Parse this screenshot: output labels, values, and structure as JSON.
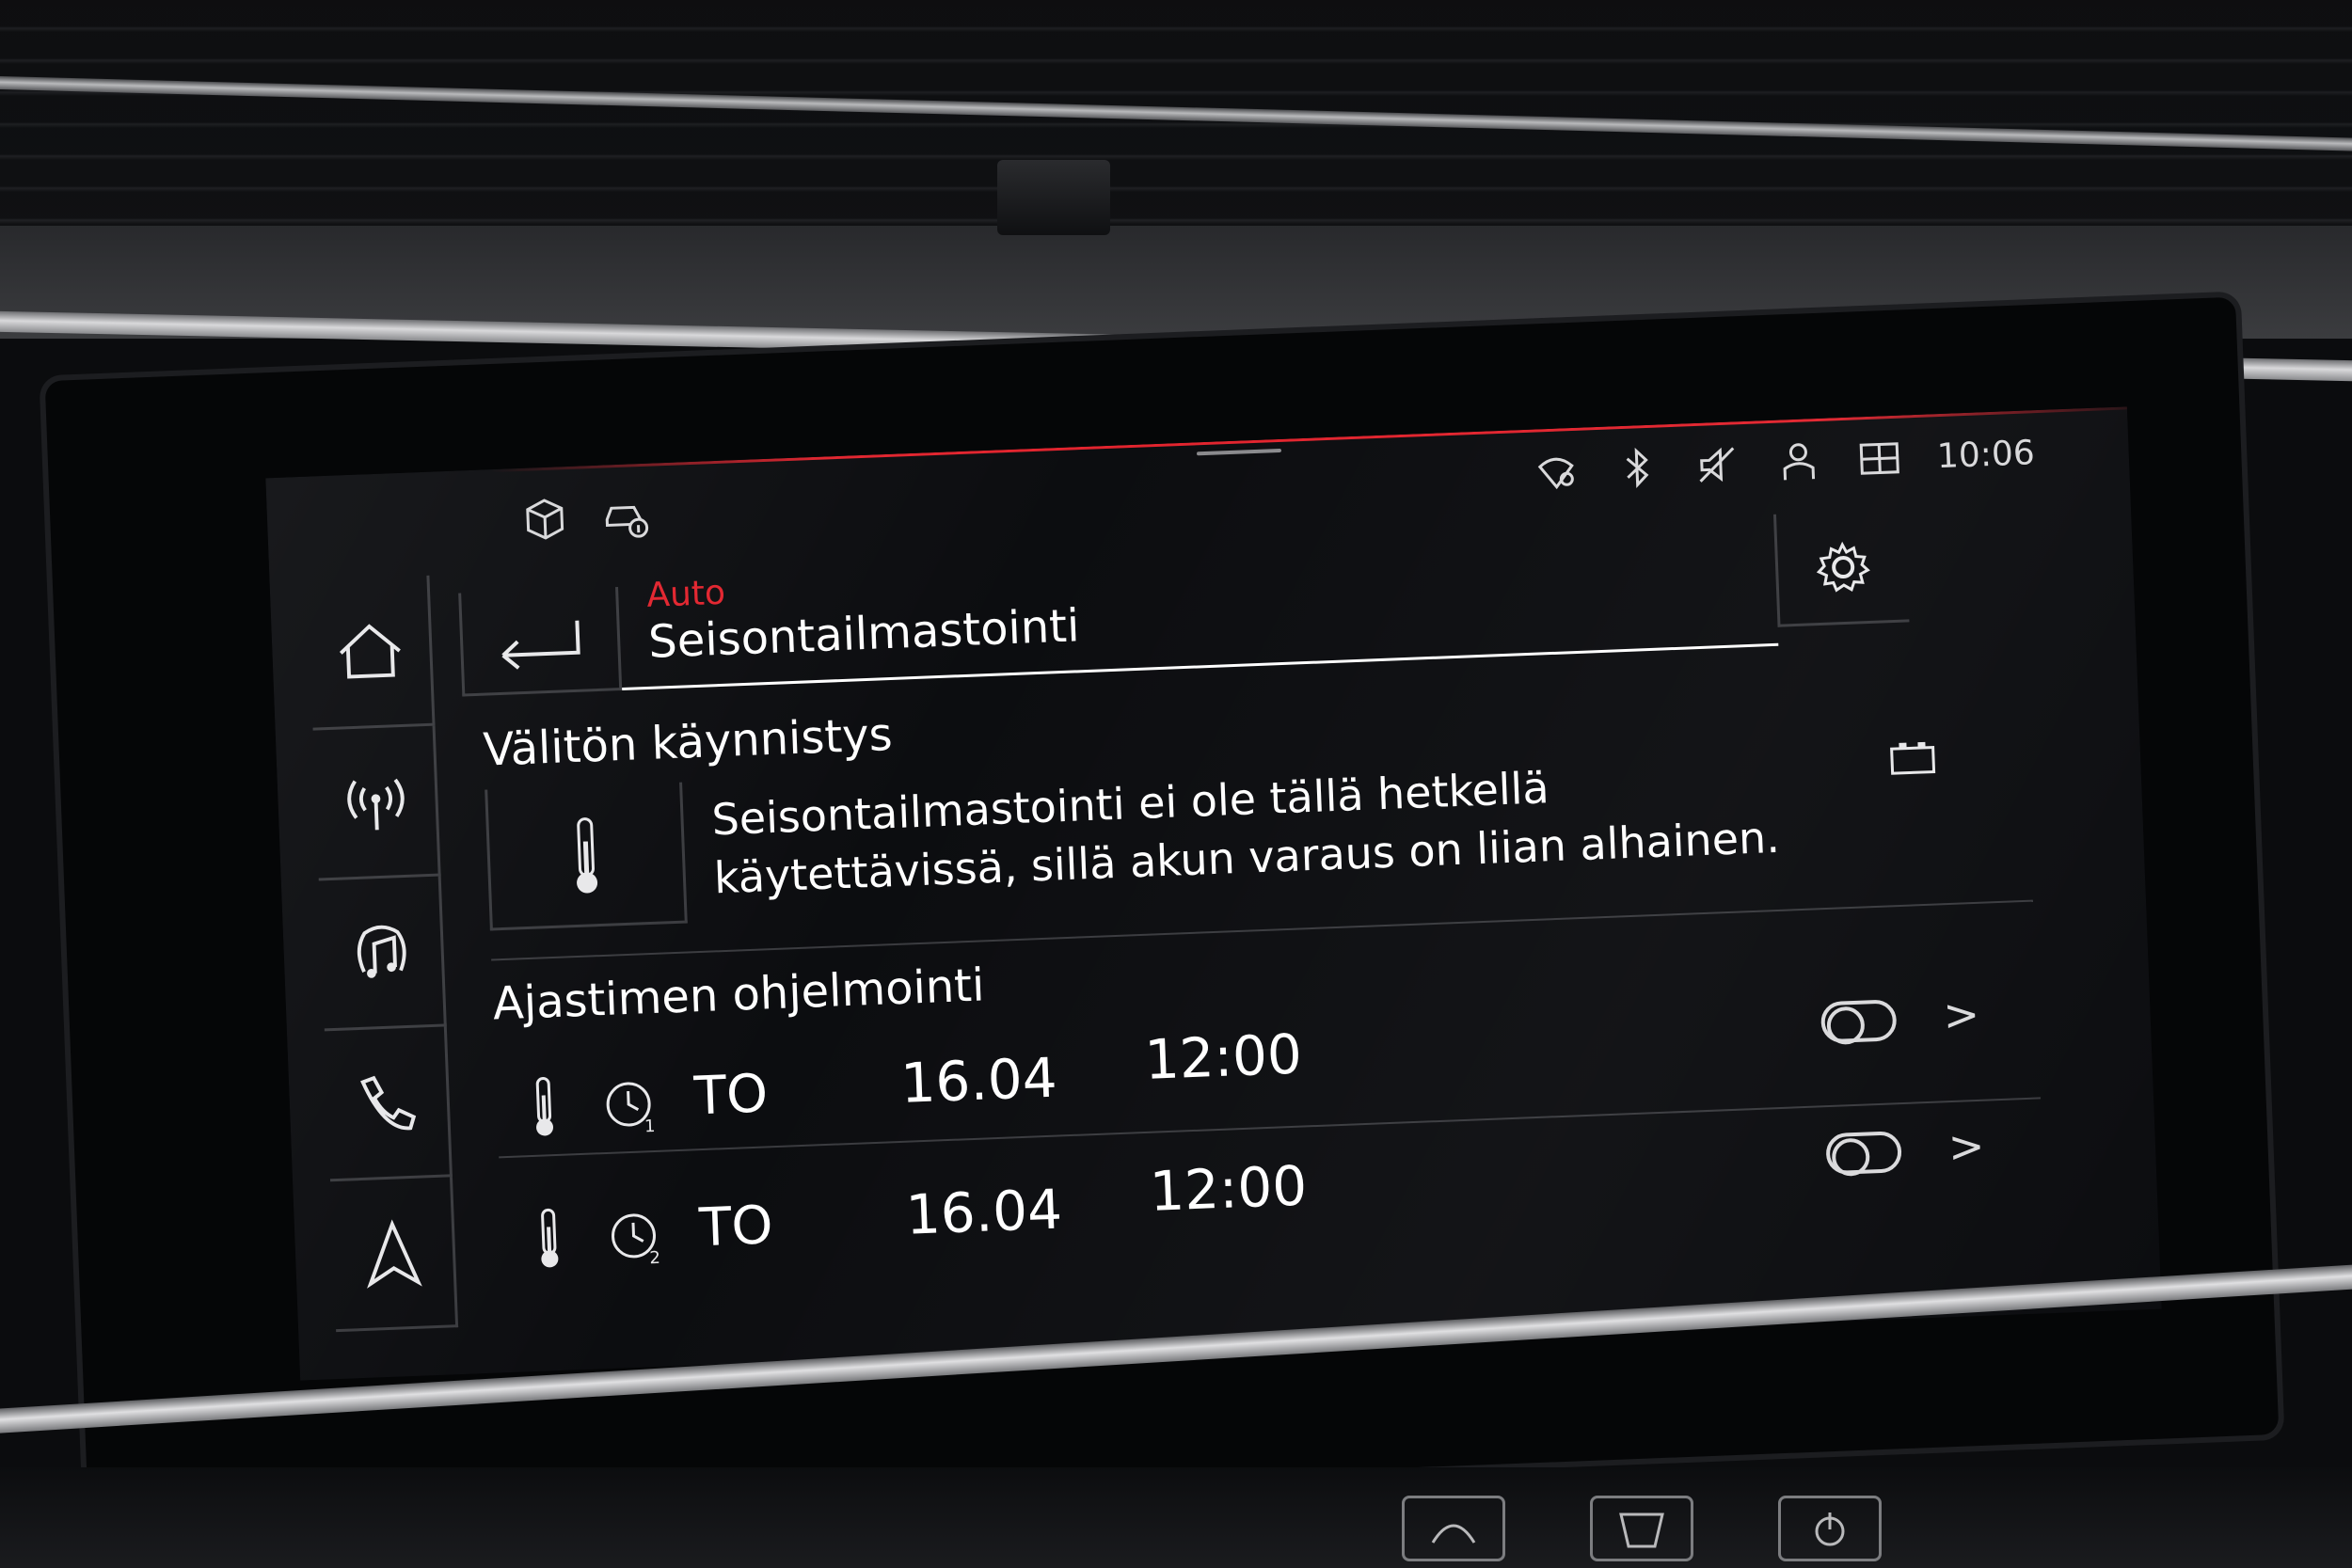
{
  "status_bar": {
    "time": "10:06",
    "left_icons": [
      "cube-icon",
      "car-info-icon"
    ],
    "right_icons": [
      "connect-location-icon",
      "bluetooth-icon",
      "mute-icon",
      "user-icon",
      "data-icon"
    ]
  },
  "nav": {
    "items": [
      {
        "id": "home",
        "icon": "home-icon"
      },
      {
        "id": "radio",
        "icon": "antenna-icon"
      },
      {
        "id": "media",
        "icon": "music-icon"
      },
      {
        "id": "phone",
        "icon": "phone-icon"
      },
      {
        "id": "navigation",
        "icon": "navigation-arrow-icon"
      }
    ]
  },
  "header": {
    "breadcrumb": "Auto",
    "title": "Seisontailmastointi"
  },
  "immediate_start": {
    "title": "Välitön käynnistys",
    "message_line1": "Seisontailmastointi ei ole tällä hetkellä",
    "message_line2": "käytettävissä, sillä akun varaus on liian alhainen."
  },
  "timer_programming": {
    "title": "Ajastimen ohjelmointi",
    "timers": [
      {
        "index": "1",
        "day": "TO",
        "date": "16.04",
        "time": "12:00",
        "enabled": false,
        "chevron": ">"
      },
      {
        "index": "2",
        "day": "TO",
        "date": "16.04",
        "time": "12:00",
        "enabled": false,
        "chevron": ">"
      }
    ]
  },
  "colors": {
    "accent_red": "#e2242e",
    "text": "#ffffff",
    "divider": "#3a3b3f",
    "screen_bg": "#0c0d10"
  }
}
